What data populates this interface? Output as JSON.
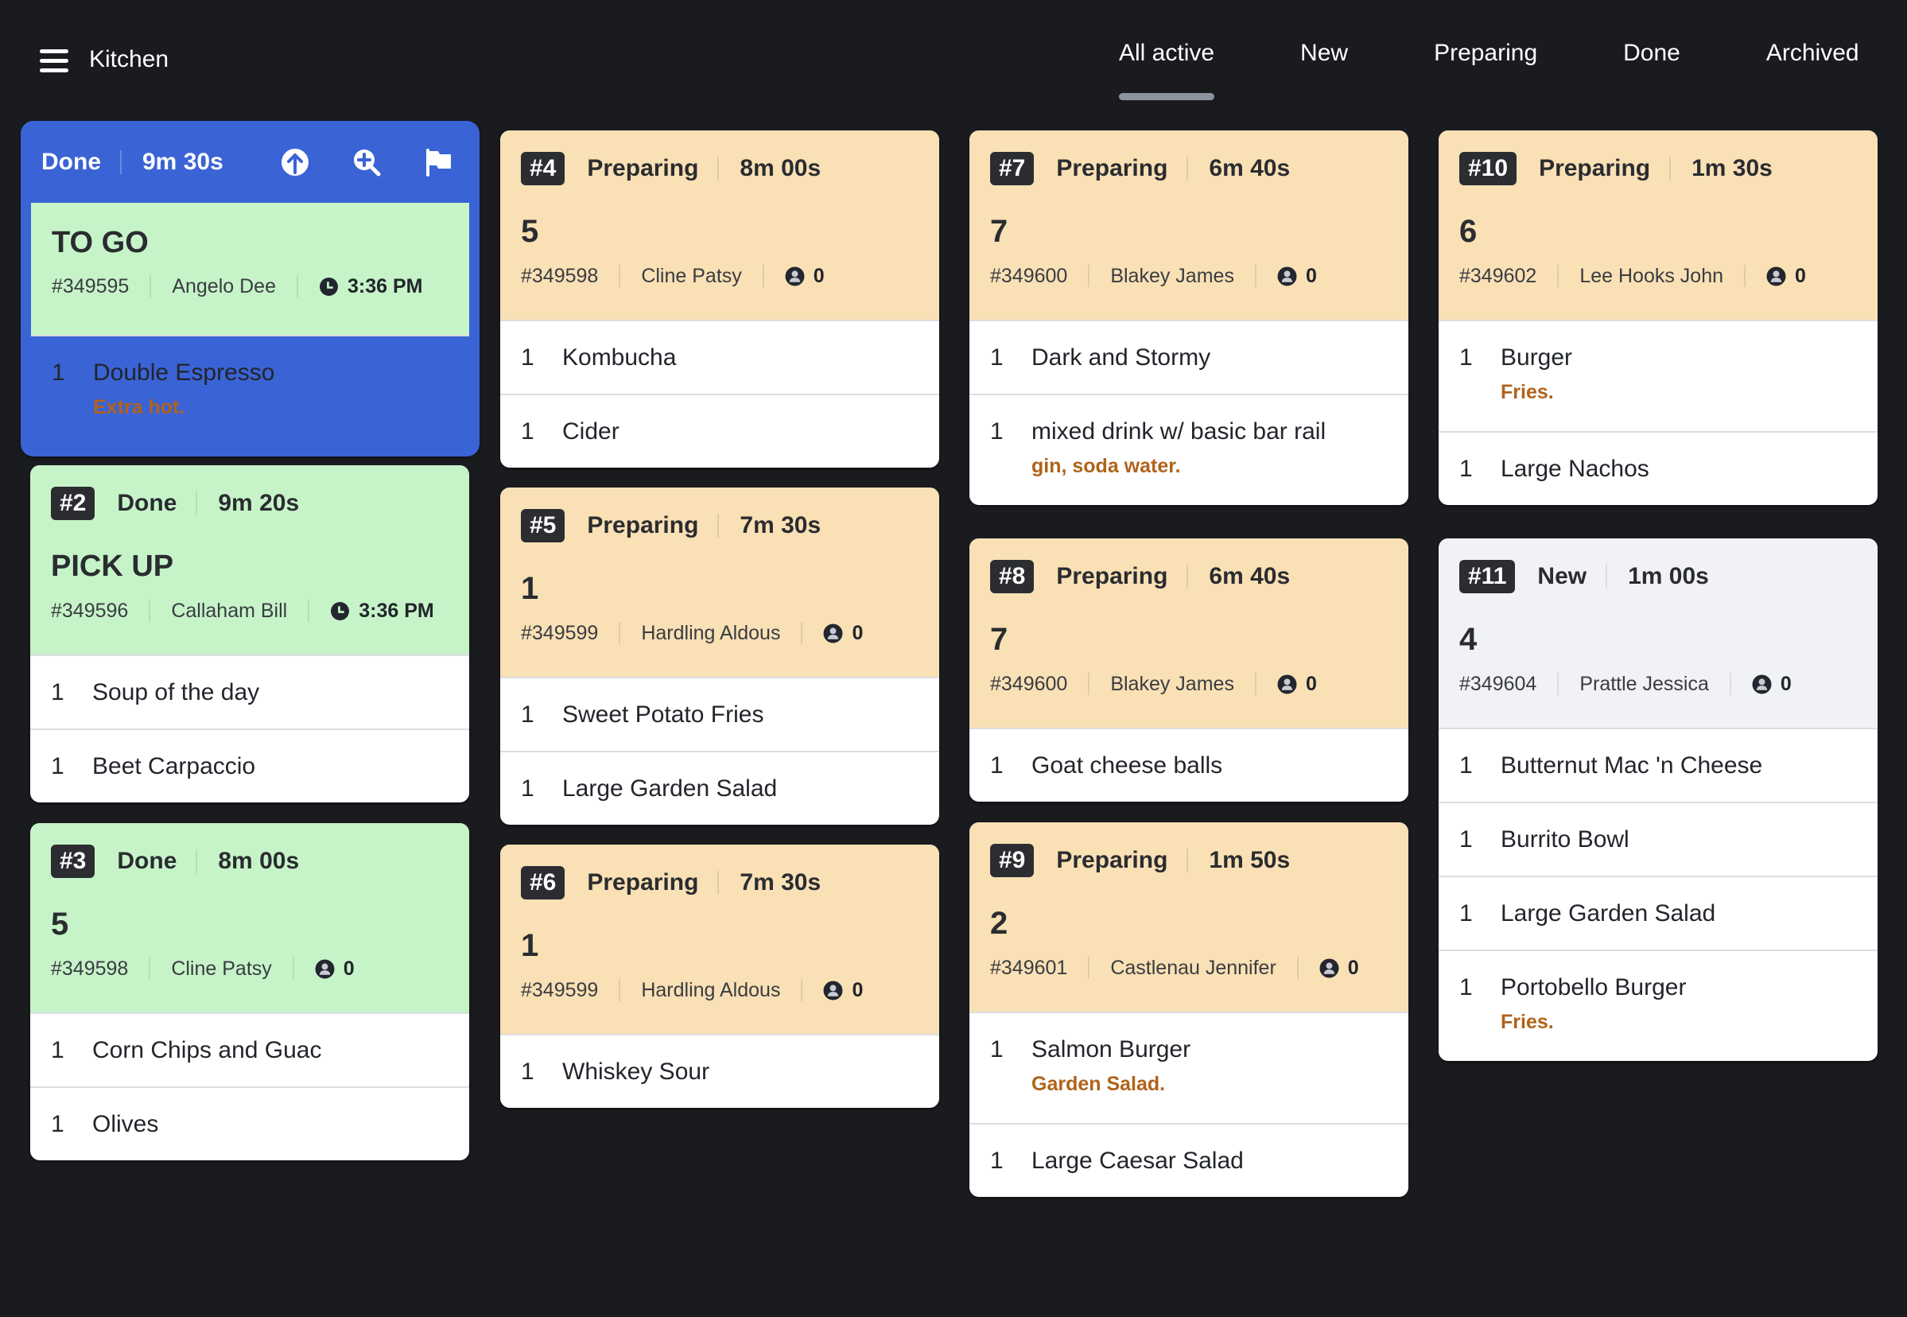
{
  "app": {
    "title": "Kitchen"
  },
  "tabs": [
    {
      "label": "All active",
      "active": true
    },
    {
      "label": "New",
      "active": false
    },
    {
      "label": "Preparing",
      "active": false
    },
    {
      "label": "Done",
      "active": false
    },
    {
      "label": "Archived",
      "active": false
    }
  ],
  "colors": {
    "background": "#1a1b1f",
    "selected_border": "#3a63d6",
    "done": "#c6f4c8",
    "preparing": "#f9e0b5",
    "new": "#f1f2f5",
    "note": "#b0631b"
  },
  "selected_card": {
    "status": "Done",
    "elapsed": "9m 30s",
    "actions": [
      "arrow-up-circle-icon",
      "zoom-in-icon",
      "flag-icon"
    ],
    "title": "TO GO",
    "order_number": "#349595",
    "customer": "Angelo Dee",
    "time": "3:36 PM",
    "items": [
      {
        "qty": "1",
        "name": "Double Espresso",
        "note": "Extra hot."
      }
    ]
  },
  "cards": [
    {
      "ticket": "#2",
      "status": "Done",
      "elapsed": "9m 20s",
      "title": "PICK UP",
      "order_number": "#349596",
      "customer": "Callaham Bill",
      "time": "3:36 PM",
      "items": [
        {
          "qty": "1",
          "name": "Soup of the day"
        },
        {
          "qty": "1",
          "name": "Beet Carpaccio"
        }
      ]
    },
    {
      "ticket": "#3",
      "status": "Done",
      "elapsed": "8m 00s",
      "title": "5",
      "order_number": "#349598",
      "customer": "Cline Patsy",
      "guests": "0",
      "items": [
        {
          "qty": "1",
          "name": "Corn Chips and Guac"
        },
        {
          "qty": "1",
          "name": "Olives"
        }
      ]
    },
    {
      "ticket": "#4",
      "status": "Preparing",
      "elapsed": "8m 00s",
      "title": "5",
      "order_number": "#349598",
      "customer": "Cline Patsy",
      "guests": "0",
      "items": [
        {
          "qty": "1",
          "name": "Kombucha"
        },
        {
          "qty": "1",
          "name": "Cider"
        }
      ]
    },
    {
      "ticket": "#5",
      "status": "Preparing",
      "elapsed": "7m 30s",
      "title": "1",
      "order_number": "#349599",
      "customer": "Hardling Aldous",
      "guests": "0",
      "items": [
        {
          "qty": "1",
          "name": "Sweet Potato Fries"
        },
        {
          "qty": "1",
          "name": "Large Garden Salad"
        }
      ]
    },
    {
      "ticket": "#6",
      "status": "Preparing",
      "elapsed": "7m 30s",
      "title": "1",
      "order_number": "#349599",
      "customer": "Hardling Aldous",
      "guests": "0",
      "items": [
        {
          "qty": "1",
          "name": "Whiskey Sour"
        }
      ]
    },
    {
      "ticket": "#7",
      "status": "Preparing",
      "elapsed": "6m 40s",
      "title": "7",
      "order_number": "#349600",
      "customer": "Blakey James",
      "guests": "0",
      "items": [
        {
          "qty": "1",
          "name": "Dark and Stormy"
        },
        {
          "qty": "1",
          "name": "mixed drink w/ basic bar rail",
          "note": "gin, soda water."
        }
      ]
    },
    {
      "ticket": "#8",
      "status": "Preparing",
      "elapsed": "6m 40s",
      "title": "7",
      "order_number": "#349600",
      "customer": "Blakey James",
      "guests": "0",
      "items": [
        {
          "qty": "1",
          "name": "Goat cheese balls"
        }
      ]
    },
    {
      "ticket": "#9",
      "status": "Preparing",
      "elapsed": "1m 50s",
      "title": "2",
      "order_number": "#349601",
      "customer": "Castlenau Jennifer",
      "guests": "0",
      "items": [
        {
          "qty": "1",
          "name": "Salmon Burger",
          "note": "Garden Salad."
        },
        {
          "qty": "1",
          "name": "Large Caesar Salad"
        }
      ]
    },
    {
      "ticket": "#10",
      "status": "Preparing",
      "elapsed": "1m 30s",
      "title": "6",
      "order_number": "#349602",
      "customer": "Lee Hooks John",
      "guests": "0",
      "items": [
        {
          "qty": "1",
          "name": "Burger",
          "note": "Fries."
        },
        {
          "qty": "1",
          "name": "Large Nachos"
        }
      ]
    },
    {
      "ticket": "#11",
      "status": "New",
      "elapsed": "1m 00s",
      "title": "4",
      "order_number": "#349604",
      "customer": "Prattle Jessica",
      "guests": "0",
      "items": [
        {
          "qty": "1",
          "name": "Butternut Mac 'n Cheese"
        },
        {
          "qty": "1",
          "name": "Burrito Bowl"
        },
        {
          "qty": "1",
          "name": "Large Garden Salad"
        },
        {
          "qty": "1",
          "name": "Portobello Burger",
          "note": "Fries."
        }
      ]
    }
  ]
}
